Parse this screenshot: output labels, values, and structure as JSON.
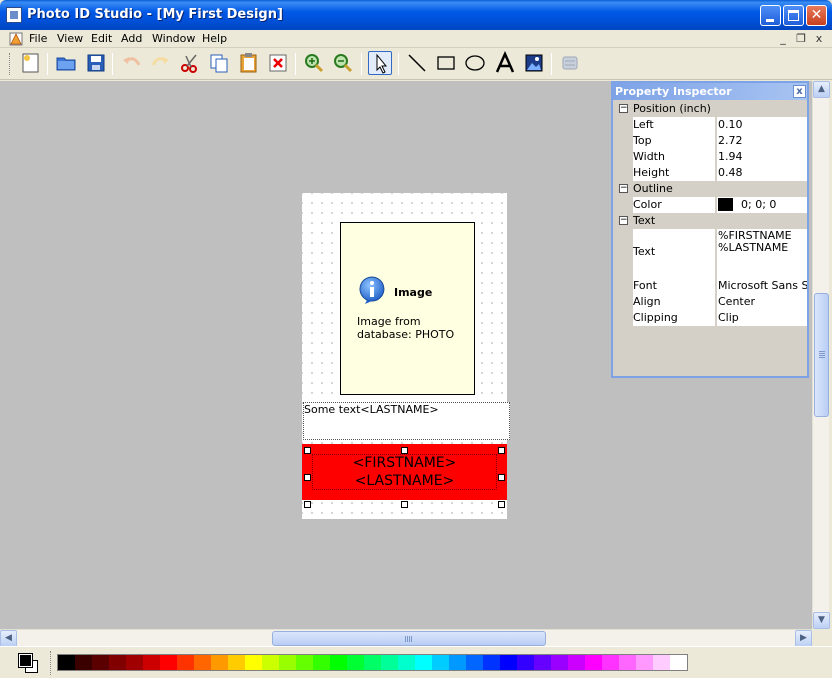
{
  "window": {
    "title": "Photo ID Studio - [My First Design]"
  },
  "menu": {
    "items": [
      "File",
      "View",
      "Edit",
      "Add",
      "Window",
      "Help"
    ],
    "mdi_controls": [
      "_",
      "❐",
      "x"
    ]
  },
  "toolbar": {
    "tools": [
      {
        "name": "new-design",
        "icon": "new-document-icon"
      },
      {
        "name": "open",
        "icon": "open-folder-icon"
      },
      {
        "name": "save",
        "icon": "save-disk-icon"
      },
      {
        "name": "undo",
        "icon": "undo-arrow-icon",
        "disabled": true
      },
      {
        "name": "redo",
        "icon": "redo-arrow-icon",
        "disabled": true
      },
      {
        "name": "cut",
        "icon": "scissors-icon"
      },
      {
        "name": "copy",
        "icon": "copy-icon"
      },
      {
        "name": "paste",
        "icon": "clipboard-icon"
      },
      {
        "name": "delete",
        "icon": "delete-x-icon"
      },
      {
        "name": "zoom-in",
        "icon": "zoom-in-icon"
      },
      {
        "name": "zoom-out",
        "icon": "zoom-out-icon"
      },
      {
        "name": "select",
        "icon": "pointer-arrow-icon",
        "active": true
      },
      {
        "name": "line",
        "icon": "line-tool-icon"
      },
      {
        "name": "rectangle",
        "icon": "rectangle-tool-icon"
      },
      {
        "name": "ellipse",
        "icon": "ellipse-tool-icon"
      },
      {
        "name": "text",
        "icon": "text-tool-icon"
      },
      {
        "name": "image",
        "icon": "image-tool-icon"
      },
      {
        "name": "database",
        "icon": "database-icon",
        "disabled": true
      }
    ]
  },
  "design": {
    "image_element": {
      "title": "Image",
      "description": "Image from database: PHOTO",
      "background": "#FFFFE1"
    },
    "text_element": {
      "text": "Some text<LASTNAME>"
    },
    "name_element": {
      "line1": "<FIRSTNAME>",
      "line2": "<LASTNAME>",
      "background": "#FF0000"
    }
  },
  "inspector": {
    "title": "Property Inspector",
    "close_label": "x",
    "position": {
      "category": "Position (inch)",
      "toggle": "−",
      "rows": [
        {
          "name": "Left",
          "value": "0.10"
        },
        {
          "name": "Top",
          "value": "2.72"
        },
        {
          "name": "Width",
          "value": "1.94"
        },
        {
          "name": "Height",
          "value": "0.48"
        }
      ]
    },
    "outline": {
      "category": "Outline",
      "toggle": "−",
      "color_name": "Color",
      "color_value": "0; 0; 0",
      "color_swatch": "#000000"
    },
    "text": {
      "category": "Text",
      "toggle": "−",
      "text_name": "Text",
      "text_value": "%FIRSTNAME\n%LASTNAME",
      "rows": [
        {
          "name": "Font",
          "value": "Microsoft Sans Serif"
        },
        {
          "name": "Align",
          "value": "Center"
        },
        {
          "name": "Clipping",
          "value": "Clip"
        }
      ]
    }
  },
  "palette": {
    "foreground": "#000000",
    "background": "#FFFFFF",
    "colors": [
      "#000000",
      "#3a0000",
      "#5a0000",
      "#800000",
      "#a00000",
      "#cc0000",
      "#ff0000",
      "#ff3300",
      "#ff6600",
      "#ff9900",
      "#ffcc00",
      "#ffff00",
      "#ccff00",
      "#99ff00",
      "#66ff00",
      "#33ff00",
      "#00ff00",
      "#00ff33",
      "#00ff66",
      "#00ff99",
      "#00ffcc",
      "#00ffff",
      "#00ccff",
      "#0099ff",
      "#0066ff",
      "#0033ff",
      "#0000ff",
      "#3300ff",
      "#6600ff",
      "#9900ff",
      "#cc00ff",
      "#ff00ff",
      "#ff33ff",
      "#ff66ff",
      "#ff99ff",
      "#ffccff",
      "#ffffff"
    ]
  }
}
